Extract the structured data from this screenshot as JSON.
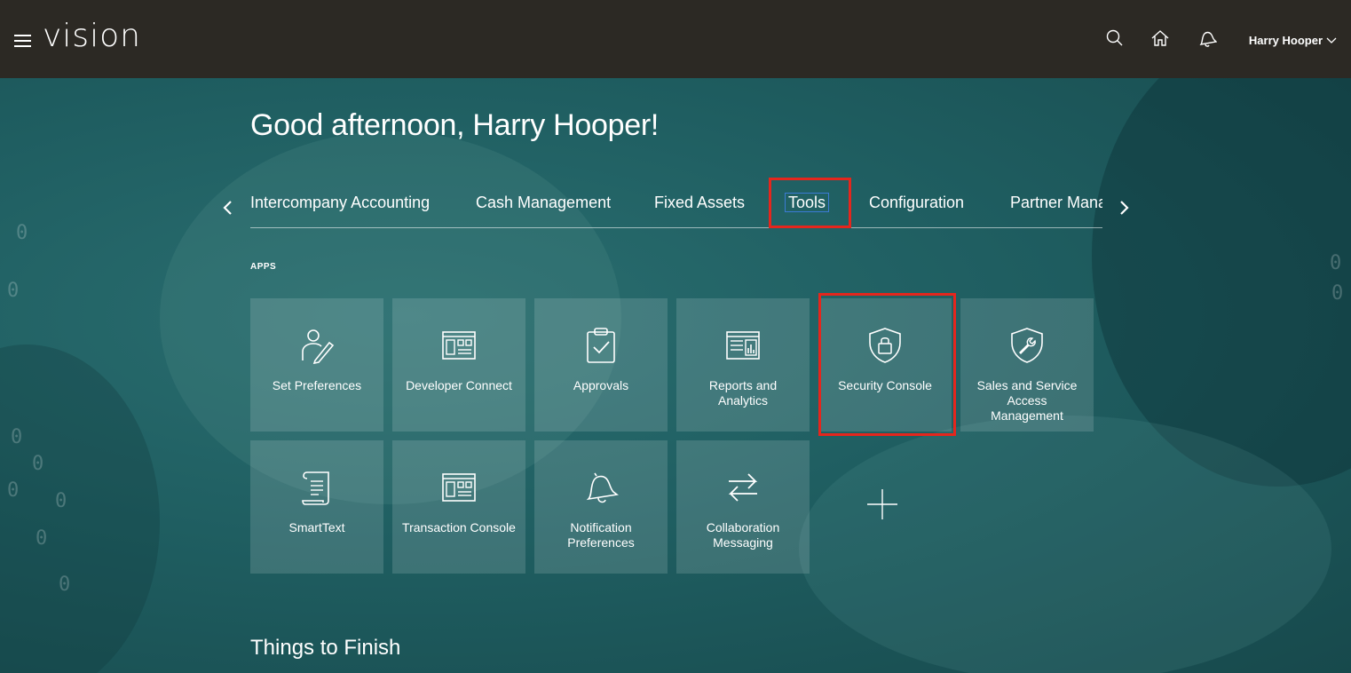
{
  "header": {
    "logo_text": "vision",
    "user_name": "Harry Hooper",
    "icons": [
      "hamburger-icon",
      "search-icon",
      "home-icon",
      "notifications-icon",
      "chevron-down-icon"
    ]
  },
  "greeting": "Good afternoon, Harry Hooper!",
  "tabs": [
    {
      "label": "Intercompany Accounting"
    },
    {
      "label": "Cash Management"
    },
    {
      "label": "Fixed Assets"
    },
    {
      "label": "Tools",
      "active": true
    },
    {
      "label": "Configuration"
    },
    {
      "label": "Partner Mana"
    }
  ],
  "apps_label": "APPS",
  "apps": [
    {
      "label": "Set Preferences",
      "icon": "person-edit-icon"
    },
    {
      "label": "Developer Connect",
      "icon": "developer-dashboard-icon"
    },
    {
      "label": "Approvals",
      "icon": "clipboard-check-icon"
    },
    {
      "label": "Reports and Analytics",
      "icon": "report-chart-icon"
    },
    {
      "label": "Security Console",
      "icon": "shield-lock-icon",
      "highlighted": true
    },
    {
      "label": "Sales and Service Access Management",
      "icon": "shield-wrench-icon"
    },
    {
      "label": "SmartText",
      "icon": "scroll-text-icon"
    },
    {
      "label": "Transaction Console",
      "icon": "console-dashboard-icon"
    },
    {
      "label": "Notification Preferences",
      "icon": "bell-icon"
    },
    {
      "label": "Collaboration Messaging",
      "icon": "exchange-arrows-icon"
    }
  ],
  "add_tile_icon": "plus-icon",
  "things_to_finish_title": "Things to Finish",
  "colors": {
    "header_bg": "#2c2924",
    "page_bg": "#1d5a5d",
    "highlight_red": "#e5261d",
    "active_tab_outline": "#3b7bd4"
  }
}
